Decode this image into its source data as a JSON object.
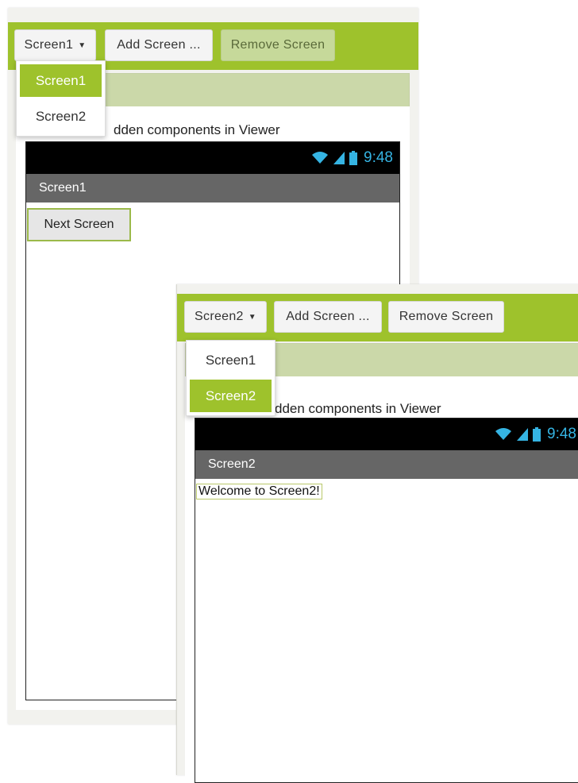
{
  "colors": {
    "toolbar_green": "#9ec22c",
    "viewer_header": "#cbd8a9",
    "status_blue": "#35b4e3",
    "title_bar_gray": "#666666"
  },
  "panel1": {
    "screen_selector": "Screen1",
    "add_screen": "Add Screen ...",
    "remove_screen": "Remove Screen",
    "remove_disabled": true,
    "dropdown": [
      {
        "label": "Screen1",
        "selected": true
      },
      {
        "label": "Screen2",
        "selected": false
      }
    ],
    "hidden_label": "dden components in Viewer",
    "status_time": "9:48",
    "title": "Screen1",
    "button_label": "Next Screen"
  },
  "panel2": {
    "screen_selector": "Screen2",
    "add_screen": "Add Screen ...",
    "remove_screen": "Remove Screen",
    "remove_disabled": false,
    "dropdown": [
      {
        "label": "Screen1",
        "selected": false
      },
      {
        "label": "Screen2",
        "selected": true
      }
    ],
    "hidden_label": "dden components in Viewer",
    "status_time": "9:48",
    "title": "Screen2",
    "label_text": "Welcome to Screen2!"
  }
}
